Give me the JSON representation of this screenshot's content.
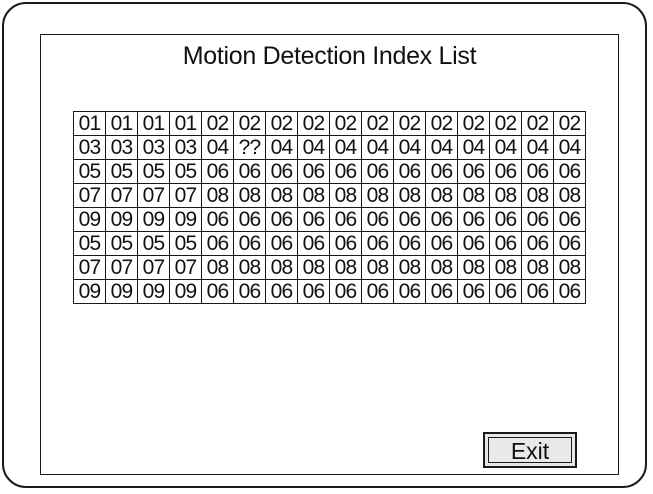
{
  "dialog": {
    "title": "Motion Detection Index List",
    "exit_label": "Exit"
  },
  "grid": {
    "rows": [
      [
        "01",
        "01",
        "01",
        "01",
        "02",
        "02",
        "02",
        "02",
        "02",
        "02",
        "02",
        "02",
        "02",
        "02",
        "02",
        "02"
      ],
      [
        "03",
        "03",
        "03",
        "03",
        "04",
        "??",
        "04",
        "04",
        "04",
        "04",
        "04",
        "04",
        "04",
        "04",
        "04",
        "04"
      ],
      [
        "05",
        "05",
        "05",
        "05",
        "06",
        "06",
        "06",
        "06",
        "06",
        "06",
        "06",
        "06",
        "06",
        "06",
        "06",
        "06"
      ],
      [
        "07",
        "07",
        "07",
        "07",
        "08",
        "08",
        "08",
        "08",
        "08",
        "08",
        "08",
        "08",
        "08",
        "08",
        "08",
        "08"
      ],
      [
        "09",
        "09",
        "09",
        "09",
        "06",
        "06",
        "06",
        "06",
        "06",
        "06",
        "06",
        "06",
        "06",
        "06",
        "06",
        "06"
      ],
      [
        "05",
        "05",
        "05",
        "05",
        "06",
        "06",
        "06",
        "06",
        "06",
        "06",
        "06",
        "06",
        "06",
        "06",
        "06",
        "06"
      ],
      [
        "07",
        "07",
        "07",
        "07",
        "08",
        "08",
        "08",
        "08",
        "08",
        "08",
        "08",
        "08",
        "08",
        "08",
        "08",
        "08"
      ],
      [
        "09",
        "09",
        "09",
        "09",
        "06",
        "06",
        "06",
        "06",
        "06",
        "06",
        "06",
        "06",
        "06",
        "06",
        "06",
        "06"
      ]
    ]
  }
}
